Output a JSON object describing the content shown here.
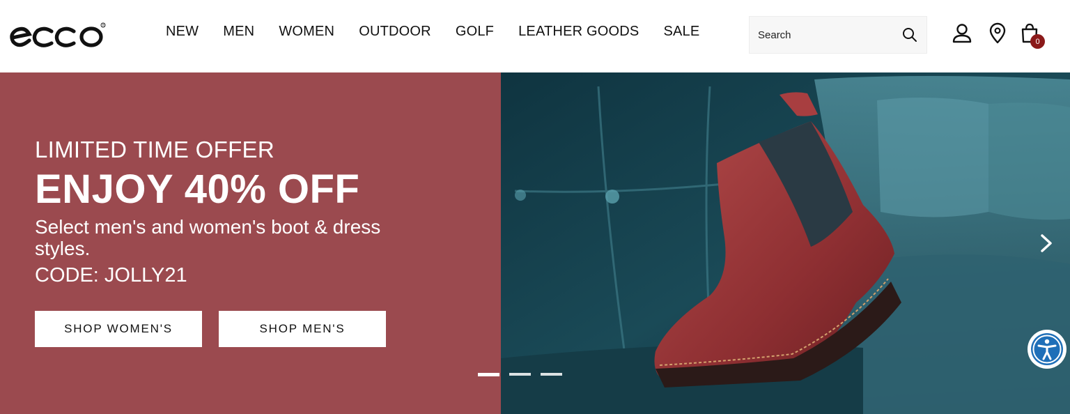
{
  "brand": {
    "logo_text": "ecco"
  },
  "nav": {
    "items": [
      {
        "label": "NEW"
      },
      {
        "label": "MEN"
      },
      {
        "label": "WOMEN"
      },
      {
        "label": "OUTDOOR"
      },
      {
        "label": "GOLF"
      },
      {
        "label": "LEATHER GOODS"
      },
      {
        "label": "SALE"
      }
    ]
  },
  "search": {
    "placeholder": "Search"
  },
  "header_icons": {
    "account": "user-icon",
    "stores": "location-pin-icon",
    "cart": "shopping-bag-icon",
    "cart_count": "0"
  },
  "hero": {
    "eyebrow": "LIMITED TIME OFFER",
    "headline": "ENJOY 40% OFF",
    "subline": "Select men's and women's boot & dress styles.",
    "code": "CODE: JOLLY21",
    "buttons": {
      "women": "SHOP WOMEN'S",
      "men": "SHOP MEN'S"
    },
    "image_subject": "red leather chelsea boot on teal velvet sofa",
    "slides": {
      "count": 3,
      "active": 1
    }
  },
  "colors": {
    "hero_panel": "#9b4a4f",
    "cart_badge": "#8b1a1a",
    "accessibility": "#1f6fb8"
  }
}
